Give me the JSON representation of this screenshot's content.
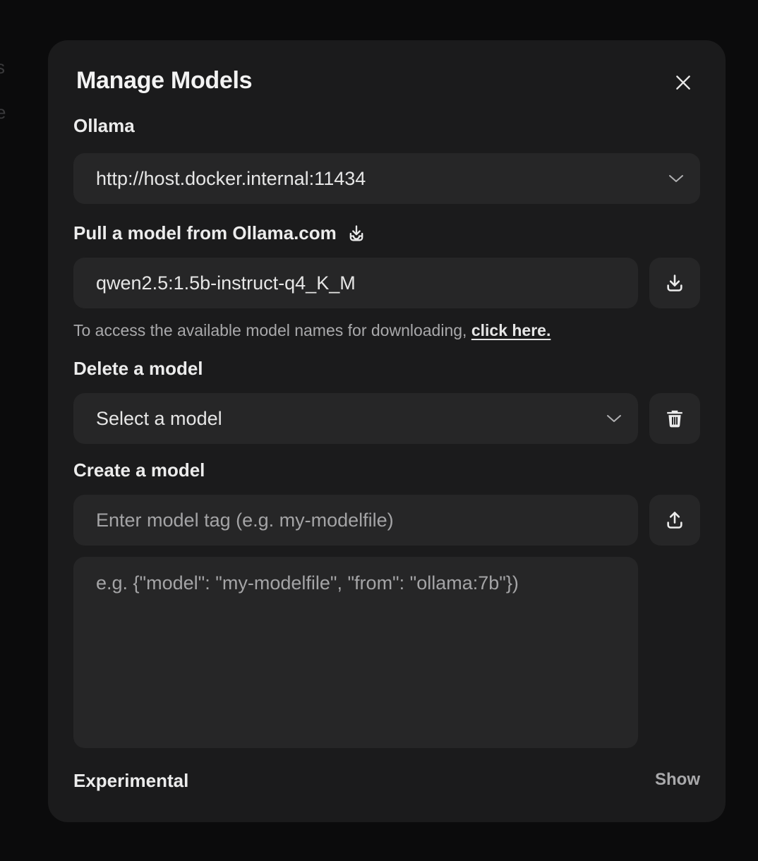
{
  "background": {
    "fragment_1": "s",
    "fragment_2": "e"
  },
  "modal": {
    "title": "Manage Models",
    "close_icon": "close-icon"
  },
  "ollama": {
    "label": "Ollama",
    "url_value": "http://host.docker.internal:11434"
  },
  "pull": {
    "label": "Pull a model from Ollama.com",
    "label_icon": "download-tray-icon",
    "input_value": "qwen2.5:1.5b-instruct-q4_K_M",
    "button_icon": "download-icon",
    "hint_text": "To access the available model names for downloading, ",
    "hint_link": "click here."
  },
  "delete": {
    "label": "Delete a model",
    "select_value": "Select a model",
    "button_icon": "trash-icon"
  },
  "create": {
    "label": "Create a model",
    "tag_placeholder": "Enter model tag (e.g. my-modelfile)",
    "button_icon": "upload-icon",
    "content_placeholder": "e.g. {\"model\": \"my-modelfile\", \"from\": \"ollama:7b\"})"
  },
  "experimental": {
    "label": "Experimental",
    "toggle_label": "Show"
  },
  "colors": {
    "modal_bg": "#1b1b1c",
    "field_bg": "#262627",
    "page_bg": "#0b0b0c"
  }
}
